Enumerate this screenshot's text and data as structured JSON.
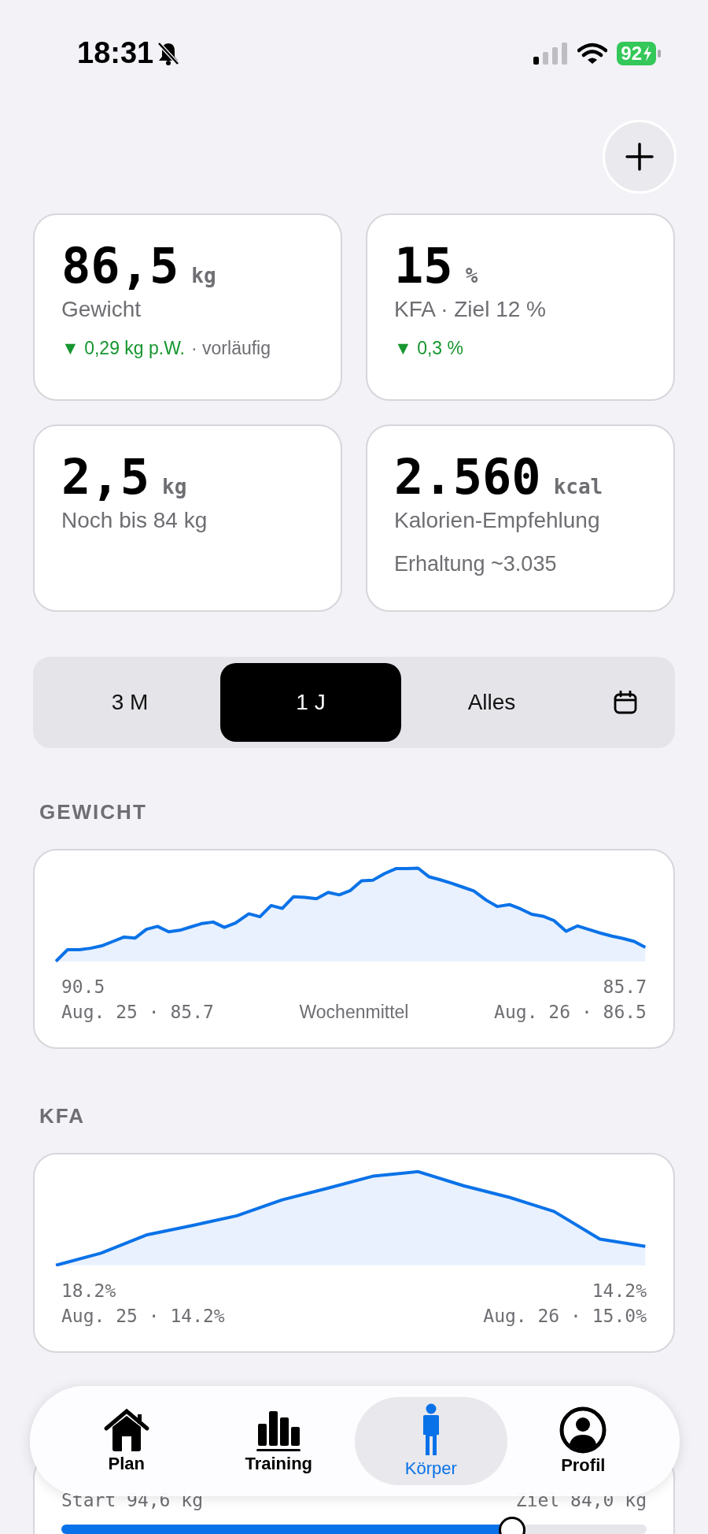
{
  "status_bar": {
    "time": "18:31",
    "battery": "92"
  },
  "stats": [
    {
      "value": "86,5",
      "unit": "kg",
      "label": "Gewicht",
      "trend": "▼ 0,29 kg p.W.",
      "trend_note": "· vorläufig"
    },
    {
      "value": "15",
      "unit": "%",
      "label": "KFA · Ziel 12 %",
      "trend": "▼ 0,3 %"
    },
    {
      "value": "2,5",
      "unit": "kg",
      "label": "Noch bis 84 kg"
    },
    {
      "value": "2.560",
      "unit": "kcal",
      "label": "Kalorien-Empfehlung",
      "note": "Erhaltung ~3.035"
    }
  ],
  "range_tabs": [
    {
      "label": "3 M",
      "selected": false
    },
    {
      "label": "1 J",
      "selected": true
    },
    {
      "label": "Alles",
      "selected": false
    }
  ],
  "charts": [
    {
      "title": "GEWICHT",
      "kind": "weight",
      "left_value": "90.5",
      "right_value": "85.7",
      "start": "Aug. 25 · 85.7",
      "center": "Wochenmittel",
      "end": "Aug. 26 · 86.5"
    },
    {
      "title": "KFA",
      "kind": "kfa",
      "left_value": "18.2%",
      "right_value": "14.2%",
      "start": "Aug. 25 · 14.2%",
      "end": "Aug. 26 · 15.0%"
    }
  ],
  "goal_progress": {
    "start": "Start 94,6 kg",
    "goal": "Ziel 84,0 kg",
    "level": 0.77
  },
  "nav": [
    {
      "label": "Plan",
      "kind": "home",
      "selected": false
    },
    {
      "label": "Training",
      "kind": "bars",
      "selected": false
    },
    {
      "label": "Körper",
      "kind": "body",
      "selected": true
    },
    {
      "label": "Profil",
      "kind": "profile",
      "selected": false
    }
  ]
}
